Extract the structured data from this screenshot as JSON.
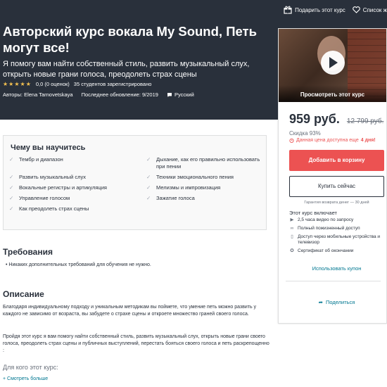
{
  "header": {
    "gift_label": "Подарить этот курс",
    "wishlist_label": "Список ж",
    "title": "Авторский курс вокала My Sound, Петь могут все!",
    "subtitle": "Я помогу вам найти собственный стиль, развить музыкальный слух, открыть новые грани голоса, преодолеть страх сцены",
    "stars": "★★★★★",
    "rating": "0,0 (0 оценок)",
    "students": "35 студентов зарегистрировано",
    "authors": "Авторы: Elena Tarnovetskaya",
    "updated": "Последнее обновление: 9/2019",
    "language": "Русский"
  },
  "sidebar": {
    "preview_label": "Просмотреть этот курс",
    "price": "959 руб.",
    "old_price": "12 799 руб.",
    "discount": "Скидка 93%",
    "deadline_text": "Данная цена доступна еще",
    "deadline_days": "4 дня!",
    "add_to_cart": "Добавить в корзину",
    "buy_now": "Купить сейчас",
    "guarantee": "Гарантия возврата денег — 30 дней",
    "includes_title": "Этот курс включает",
    "includes": [
      {
        "icon": "video-icon",
        "text": "2,5 часа видео по запросу"
      },
      {
        "icon": "infinity-icon",
        "text": "Полный пожизненный доступ"
      },
      {
        "icon": "mobile-icon",
        "text": "Доступ через мобильные устройства и телевизор"
      },
      {
        "icon": "certificate-icon",
        "text": "Сертификат об окончании"
      }
    ],
    "coupon": "Использовать купон",
    "share": "Поделиться"
  },
  "learn": {
    "title": "Чему вы научитесь",
    "items": [
      "Тембр и диапазон",
      "Дыхание, как его правильно использовать при пении",
      "Развить музыкальный слух",
      "Техники эмоционального пения",
      "Вокальные регистры и артикуляция",
      "Мелизмы и импровизация",
      "Управление голосом",
      "Зажатие голоса",
      "Как преодолеть страх сцены"
    ]
  },
  "requirements": {
    "title": "Требования",
    "item": "Никаких дополнительных требований для обучения не нужно."
  },
  "description": {
    "title": "Описание",
    "p1": "Благодаря индивидуальному подходу и уникальным методикам вы поймете, что умение петь можно развить у каждого не зависимо от возраста, вы забудете о страхе сцены и откроете множество граней своего голоса.",
    "p2": "Пройдя этот курс я вам помогу найти собственный стиль, развить музыкальный слух, открыть новые грани своего голоса, преодолеть страх сцены и публичных выступлений, перестать бояться своего голоса и петь раскрепощенно :",
    "who_title": "Для кого этот курс:",
    "show_more": "+ Смотреть больше"
  },
  "colors": {
    "hero_bg": "#29303b",
    "accent_red": "#ec5252",
    "link_blue": "#007791",
    "star": "#f4c150"
  }
}
